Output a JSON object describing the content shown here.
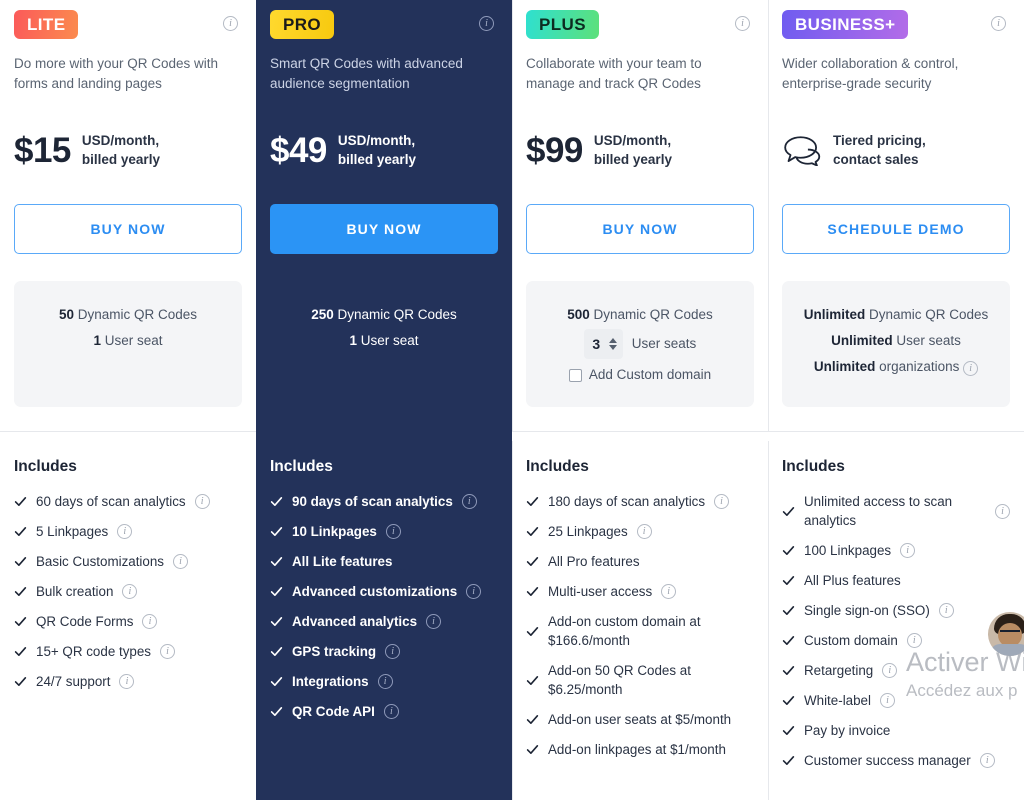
{
  "plans": [
    {
      "id": "lite",
      "badge": "LITE",
      "description": "Do more with your QR Codes with forms and landing pages",
      "price": "$15",
      "price_note_line1": "USD/month,",
      "price_note_line2": "billed yearly",
      "cta": "BUY NOW",
      "cta_style": "outline",
      "quota": [
        {
          "strong": "50",
          "rest": " Dynamic QR Codes"
        },
        {
          "strong": "1",
          "rest": " User seat"
        }
      ],
      "includes_title": "Includes",
      "features": [
        {
          "label": "60 days of scan analytics",
          "info": true
        },
        {
          "label": "5 Linkpages",
          "info": true
        },
        {
          "label": "Basic Customizations",
          "info": true
        },
        {
          "label": "Bulk creation",
          "info": true
        },
        {
          "label": "QR Code Forms",
          "info": true
        },
        {
          "label": "15+ QR code types",
          "info": true
        },
        {
          "label": "24/7 support",
          "info": true
        }
      ]
    },
    {
      "id": "pro",
      "badge": "PRO",
      "description": "Smart QR Codes with advanced audience segmentation",
      "price": "$49",
      "price_note_line1": "USD/month,",
      "price_note_line2": "billed yearly",
      "cta": "BUY NOW",
      "cta_style": "filled",
      "quota": [
        {
          "strong": "250",
          "rest": " Dynamic QR Codes"
        },
        {
          "strong": "1",
          "rest": " User seat"
        }
      ],
      "includes_title": "Includes",
      "features": [
        {
          "label": "90 days of scan analytics",
          "info": true
        },
        {
          "label": "10 Linkpages",
          "info": true
        },
        {
          "label": "All Lite features",
          "info": false
        },
        {
          "label": "Advanced customizations",
          "info": true
        },
        {
          "label": "Advanced analytics",
          "info": true
        },
        {
          "label": "GPS tracking",
          "info": true
        },
        {
          "label": "Integrations",
          "info": true
        },
        {
          "label": "QR Code API",
          "info": true
        }
      ]
    },
    {
      "id": "plus",
      "badge": "PLUS",
      "description": "Collaborate with your team to manage and track QR Codes",
      "price": "$99",
      "price_note_line1": "USD/month,",
      "price_note_line2": "billed yearly",
      "cta": "BUY NOW",
      "cta_style": "outline",
      "quota": [
        {
          "strong": "500",
          "rest": " Dynamic QR Codes"
        }
      ],
      "seat_stepper_value": "3",
      "seat_stepper_label": "User seats",
      "custom_domain_checkbox_label": "Add Custom domain",
      "custom_domain_checked": false,
      "includes_title": "Includes",
      "features": [
        {
          "label": "180 days of scan analytics",
          "info": true
        },
        {
          "label": "25 Linkpages",
          "info": true
        },
        {
          "label": "All Pro features",
          "info": false
        },
        {
          "label": "Multi-user access",
          "info": true
        },
        {
          "label": "Add-on custom domain at $166.6/month",
          "info": false
        },
        {
          "label": "Add-on 50 QR Codes at $6.25/month",
          "info": false
        },
        {
          "label": "Add-on user seats at $5/month",
          "info": false
        },
        {
          "label": "Add-on linkpages at $1/month",
          "info": false
        }
      ]
    },
    {
      "id": "business",
      "badge": "BUSINESS+",
      "description": "Wider collaboration & control, enterprise-grade security",
      "price": "",
      "price_note_line1": "Tiered pricing,",
      "price_note_line2": "contact sales",
      "cta": "SCHEDULE DEMO",
      "cta_style": "outline",
      "quota": [
        {
          "strong": "Unlimited",
          "rest": " Dynamic QR Codes"
        },
        {
          "strong": "Unlimited",
          "rest": " User seats"
        },
        {
          "strong": "Unlimited",
          "rest": " organizations",
          "info": true
        }
      ],
      "includes_title": "Includes",
      "features": [
        {
          "label": "Unlimited access to scan analytics",
          "info": true
        },
        {
          "label": "100 Linkpages",
          "info": true
        },
        {
          "label": "All Plus features",
          "info": false
        },
        {
          "label": "Single sign-on (SSO)",
          "info": true
        },
        {
          "label": "Custom domain",
          "info": true
        },
        {
          "label": "Retargeting",
          "info": true
        },
        {
          "label": "White-label",
          "info": true
        },
        {
          "label": "Pay by invoice",
          "info": false
        },
        {
          "label": "Customer success manager",
          "info": true
        }
      ]
    }
  ],
  "watermark": {
    "title": "Activer Win",
    "subtitle": "Accédez aux p"
  },
  "colors": {
    "accent_blue": "#2b94f5",
    "dark_panel": "#23325a",
    "quota_bg": "#f4f5f7",
    "badge_lite": "#fb5a5a",
    "badge_pro": "#ffd92e",
    "badge_plus": "#2ee0d0",
    "badge_business": "#6f5cf0"
  }
}
